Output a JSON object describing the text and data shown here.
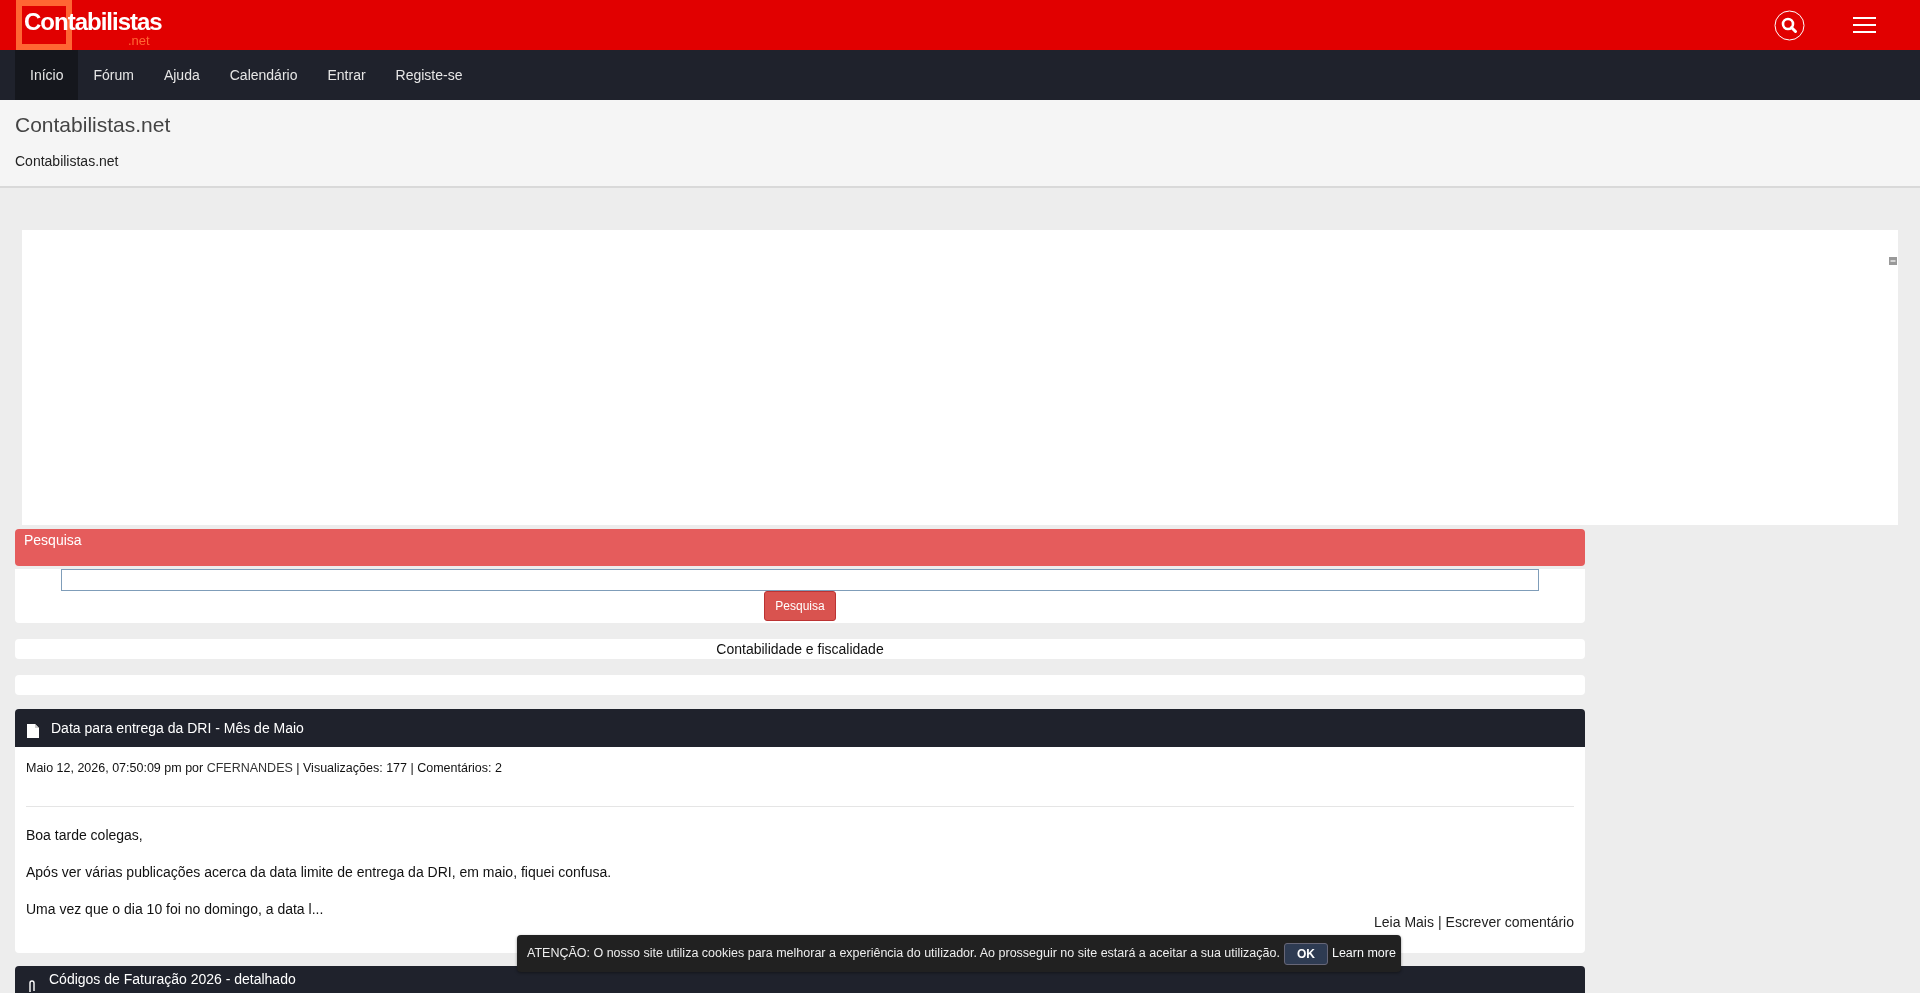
{
  "header": {
    "logo": {
      "initial": "C",
      "name": "ontabilistas",
      "suffix": ".net"
    }
  },
  "nav": [
    {
      "label": "Início",
      "selected": true
    },
    {
      "label": "Fórum",
      "selected": false
    },
    {
      "label": "Ajuda",
      "selected": false
    },
    {
      "label": "Calendário",
      "selected": false
    },
    {
      "label": "Entrar",
      "selected": false
    },
    {
      "label": "Registe-se",
      "selected": false
    }
  ],
  "site": {
    "title": "Contabilistas.net",
    "subtitle": "Contabilistas.net"
  },
  "search_panel": {
    "title": "Pesquisa",
    "button": "Pesquisa"
  },
  "tagline": "Contabilidade e fiscalidade",
  "articles": [
    {
      "kind": "document",
      "title": "Data para entrega da DRI - Mês de Maio",
      "date": "Maio 12, 2026, 07:50:09 pm",
      "by": "por",
      "author": "CFERNANDES",
      "stats": "| Visualizações: 177 | Comentários: 2",
      "paragraphs": [
        "Boa tarde colegas,",
        "Após ver várias publicações acerca da data limite de entrega da DRI, em maio, fiquei confusa.",
        "Uma vez que o dia 10 foi no domingo, a data l..."
      ],
      "read_more": "Leia Mais",
      "separator": "|",
      "comment": "Escrever comentário"
    },
    {
      "kind": "attachment",
      "title": "Códigos de Faturação 2026 - detalhado"
    }
  ],
  "cookie_bar": {
    "text": "ATENÇÃO: O nosso site utiliza cookies para melhorar a experiência do utilizador. Ao prosseguir no site estará a aceitar a sua utilização.",
    "ok": "OK",
    "learn_more": "Learn more"
  }
}
